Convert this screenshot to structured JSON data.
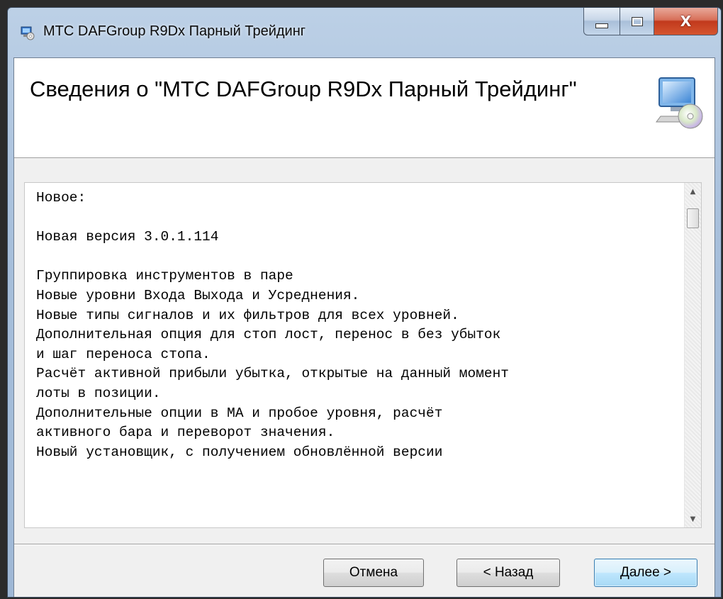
{
  "window": {
    "title": "МТС DAFGroup R9Dx Парный Трейдинг",
    "caption_buttons": {
      "minimize_icon": "minimize-icon",
      "maximize_icon": "maximize-icon",
      "close_glyph": "X"
    }
  },
  "header": {
    "title": "Сведения о \"МТС DAFGroup R9Dx Парный Трейдинг\"",
    "icon": "computer-cd-icon"
  },
  "release_notes": {
    "lines": [
      "Новое:",
      "",
      "Новая версия 3.0.1.114",
      "",
      "Группировка инструментов в паре",
      "Новые уровни Входа Выхода и Усреднения.",
      "Новые типы сигналов и их фильтров для всех уровней.",
      "Дополнительная опция для стоп лост, перенос в без убыток",
      "и шаг переноса стопа.",
      "Расчёт активной прибыли убытка, открытые на данный момент",
      "лоты в позиции.",
      "Дополнительные опции в МА и пробое уровня, расчёт",
      "активного бара и переворот значения.",
      "Новый установщик, с получением обновлённой версии"
    ],
    "scroll_position": 0
  },
  "buttons": {
    "cancel": "Отмена",
    "back": "< Назад",
    "next": "Далее >"
  },
  "colors": {
    "window_frame": "#a7bfdb",
    "close_button": "#c1391c",
    "default_button_border": "#3c7fb1"
  }
}
